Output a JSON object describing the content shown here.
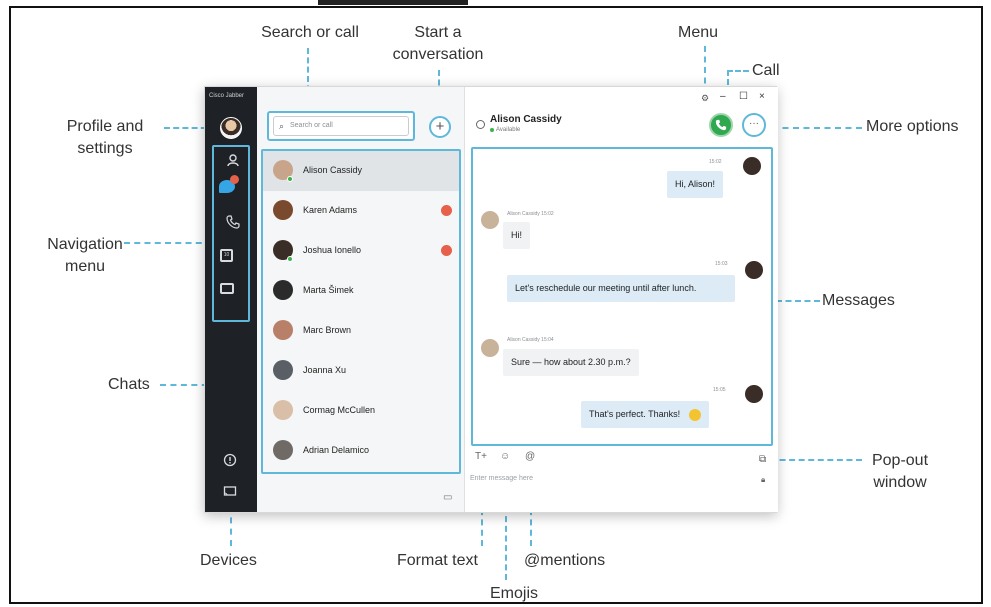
{
  "annotations": {
    "search_or_call": "Search or call",
    "start_conversation_l1": "Start a",
    "start_conversation_l2": "conversation",
    "menu": "Menu",
    "call": "Call",
    "profile_l1": "Profile and",
    "profile_l2": "settings",
    "more_options": "More options",
    "navigation_l1": "Navigation",
    "navigation_l2": "menu",
    "messages": "Messages",
    "chats": "Chats",
    "popout_l1": "Pop-out",
    "popout_l2": "window",
    "devices": "Devices",
    "format_text": "Format text",
    "mentions": "@mentions",
    "emojis": "Emojis"
  },
  "app": {
    "name": "Cisco Jabber",
    "search_placeholder": "Search or call",
    "new_conversation_icon": "+",
    "chats": [
      {
        "name": "Alison Cassidy",
        "active": true,
        "presence": true,
        "unread": false
      },
      {
        "name": "Karen Adams",
        "active": false,
        "presence": false,
        "unread": true
      },
      {
        "name": "Joshua Ionello",
        "active": false,
        "presence": true,
        "unread": true
      },
      {
        "name": "Marta Šimek",
        "active": false,
        "presence": false,
        "unread": false
      },
      {
        "name": "Marc Brown",
        "active": false,
        "presence": false,
        "unread": false
      },
      {
        "name": "Joanna Xu",
        "active": false,
        "presence": false,
        "unread": false
      },
      {
        "name": "Cormag McCullen",
        "active": false,
        "presence": false,
        "unread": false
      },
      {
        "name": "Adrian Delamico",
        "active": false,
        "presence": false,
        "unread": false
      }
    ],
    "conversation": {
      "contact": "Alison Cassidy",
      "status": "Available",
      "messages": [
        {
          "dir": "out",
          "time": "15:02",
          "text": "Hi, Alison!"
        },
        {
          "dir": "in",
          "meta": "Alison Cassidy 15:02",
          "text": "Hi!"
        },
        {
          "dir": "out",
          "time": "15:03",
          "text": "Let's reschedule our meeting until after lunch."
        },
        {
          "dir": "in",
          "meta": "Alison Cassidy 15:04",
          "text": "Sure — how about 2.30 p.m.?"
        },
        {
          "dir": "out",
          "time": "15:05",
          "text": "That's perfect. Thanks!"
        }
      ],
      "composer_placeholder": "Enter message here",
      "format_icon": "T+",
      "emoji_icon": "☺",
      "mention_icon": "@"
    },
    "window": {
      "minimize": "–",
      "maximize": "☐",
      "close": "×"
    }
  },
  "icon_names": [
    "profile-avatar-icon",
    "contacts-icon",
    "chats-icon",
    "calls-icon",
    "meetings-icon",
    "voicemail-icon",
    "help-icon",
    "devices-icon",
    "search-icon",
    "gear-icon",
    "call-icon",
    "more-icon",
    "popout-icon",
    "lock-icon",
    "screen-share-icon"
  ],
  "colors": {
    "accent": "#5fb8d9",
    "rail": "#1e2226",
    "call": "#2fa84f",
    "unread": "#e6604a"
  }
}
